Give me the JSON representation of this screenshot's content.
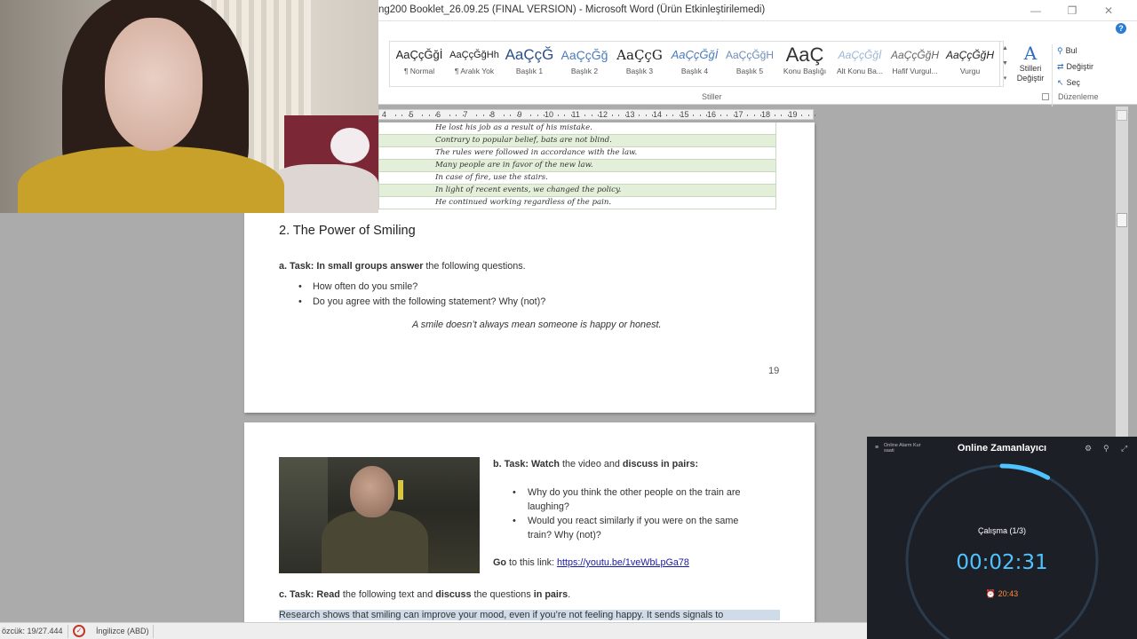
{
  "window": {
    "title": "ng200 Booklet_26.09.25 (FINAL VERSION)  -  Microsoft Word (Ürün Etkinleştirilemedi)",
    "minimize": "—",
    "restore": "❐",
    "close": "✕",
    "help": "?"
  },
  "ribbon": {
    "styles": [
      {
        "sample": "AaÇçĞğİ",
        "name": "¶ Normal"
      },
      {
        "sample": "AaÇçĞğHh",
        "name": "¶ Aralık Yok"
      },
      {
        "sample": "AaÇçĞ",
        "name": "Başlık 1"
      },
      {
        "sample": "AaÇçĞğ",
        "name": "Başlık 2"
      },
      {
        "sample": "AaÇçG",
        "name": "Başlık 3"
      },
      {
        "sample": "AaÇçĞğİ",
        "name": "Başlık 4"
      },
      {
        "sample": "AaÇçĞğH",
        "name": "Başlık 5"
      },
      {
        "sample": "AaÇ",
        "name": "Konu Başlığı"
      },
      {
        "sample": "AaÇçĞğİ",
        "name": "Alt Konu Ba..."
      },
      {
        "sample": "AaÇçĞğH",
        "name": "Hafif Vurgul..."
      },
      {
        "sample": "AaÇçĞğH",
        "name": "Vurgu"
      }
    ],
    "styles_group_label": "Stiller",
    "change_styles_label": "Stilleri Değiştir",
    "editing_group_label": "Düzenleme",
    "find_label": "Bul",
    "replace_label": "Değiştir",
    "select_label": "Seç"
  },
  "ruler": {
    "numbers": [
      "4",
      "5",
      "6",
      "7",
      "8",
      "9",
      "10",
      "11",
      "12",
      "13",
      "14",
      "15",
      "16",
      "17",
      "18",
      "19"
    ]
  },
  "page1": {
    "table_rows": [
      "He lost his job as a result of his mistake.",
      "Contrary to popular belief, bats are not blind.",
      "The rules were followed in accordance with the law.",
      "Many people are in favor of the new law.",
      "In case of fire, use the stairs.",
      "In light of recent events, we changed the policy.",
      "He continued working regardless of the pain."
    ],
    "heading": "2. The Power of Smiling",
    "task_a_prefix": "a. Task:",
    "task_a_bold": "In small groups answer",
    "task_a_rest": "the following questions.",
    "bullets": [
      "How often do you smile?",
      "Do you agree with the following statement? Why (not)?"
    ],
    "quote": "A smile doesn’t always mean someone is happy or honest.",
    "page_number": "19"
  },
  "page2": {
    "task_b_prefix": "b. Task:",
    "task_b_bold1": "Watch",
    "task_b_mid": "the video and",
    "task_b_bold2": "discuss in pairs:",
    "bullets": [
      [
        "Why do you think the other people on the train are",
        "laughing?"
      ],
      [
        "Would you react similarly if you were on the same",
        "train? Why (not)?"
      ]
    ],
    "goto_bold": "Go",
    "goto_rest": "to this link:",
    "link": "https://youtu.be/1veWbLpGa78",
    "task_c_prefix": "c. Task:",
    "task_c_bold1": "Read",
    "task_c_mid": "the following text and",
    "task_c_bold2": "discuss",
    "task_c_mid2": "the questions",
    "task_c_bold3": "in pairs",
    "task_c_end": ".",
    "selected_text": "Research shows that smiling can improve your mood, even if you’re not feeling happy. It sends signals to"
  },
  "statusbar": {
    "word_count": "özcük: 19/27.444",
    "language": "İngilizce (ABD)"
  },
  "timer": {
    "app_name": "Online Alarm Kur",
    "app_sub": "saati",
    "title": "Online Zamanlayıcı",
    "phase": "Çalışma (1/3)",
    "time": "00:02:31",
    "alarm_time": "20:43",
    "progress": 0.08,
    "accent": "#4fc3ff",
    "alarm_color": "#ff8a3d"
  },
  "colors": {
    "table_alt_row": "#e3efd9",
    "link": "#1a1aa6",
    "selection": "#cfdbe8",
    "word_blue": "#2b6cc4"
  }
}
